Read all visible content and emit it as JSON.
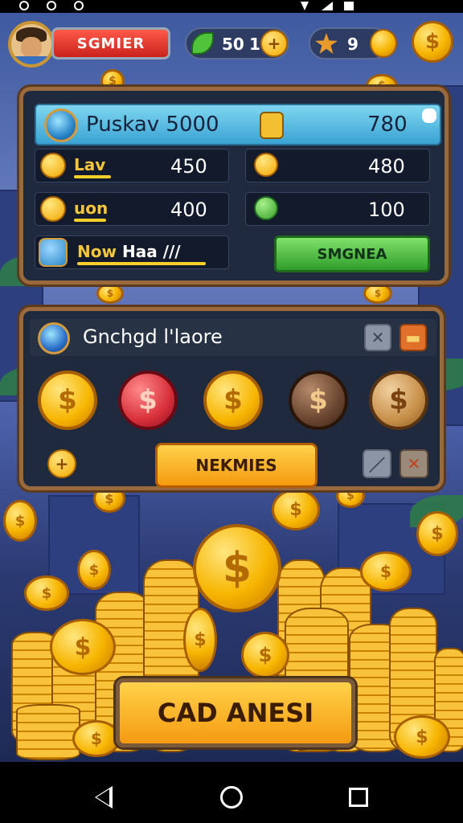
{
  "status": {
    "icons": [
      "circle-icon",
      "circle-icon",
      "circle-icon"
    ],
    "right_icons": [
      "wifi-icon",
      "signal-icon",
      "battery-icon"
    ]
  },
  "topbar": {
    "player_name": "SGMIER",
    "resource_gems": {
      "value": "50",
      "second": "1",
      "plus": "+",
      "icon": "leaf-gem-icon"
    },
    "resource_stars": {
      "value": "9",
      "icon": "star-icon"
    },
    "coin_symbol": "$"
  },
  "main_panel": {
    "title": "Puskav 5000",
    "header_value": "780",
    "rows": [
      {
        "label": "Lav",
        "value": "450",
        "right_value": "480"
      },
      {
        "label": "uon",
        "value": "400",
        "right_value": "100"
      },
      {
        "label": "Now",
        "extra": "Haa ///"
      }
    ],
    "action_button": "SMGNEA"
  },
  "shop_panel": {
    "title": "Gnchgd l'laore",
    "coins": [
      "$",
      "$",
      "$",
      "$",
      "$"
    ],
    "plus": "+",
    "main_button": "NEKMIES"
  },
  "bottom": {
    "cta_button": "CAD ANESI"
  },
  "colors": {
    "accent_gold": "#f7b500",
    "panel_border": "#9b6a3c",
    "green": "#2f9d2a",
    "red": "#c9221c"
  },
  "nav": {
    "back": "back-icon",
    "home": "home-icon",
    "recents": "recents-icon"
  }
}
